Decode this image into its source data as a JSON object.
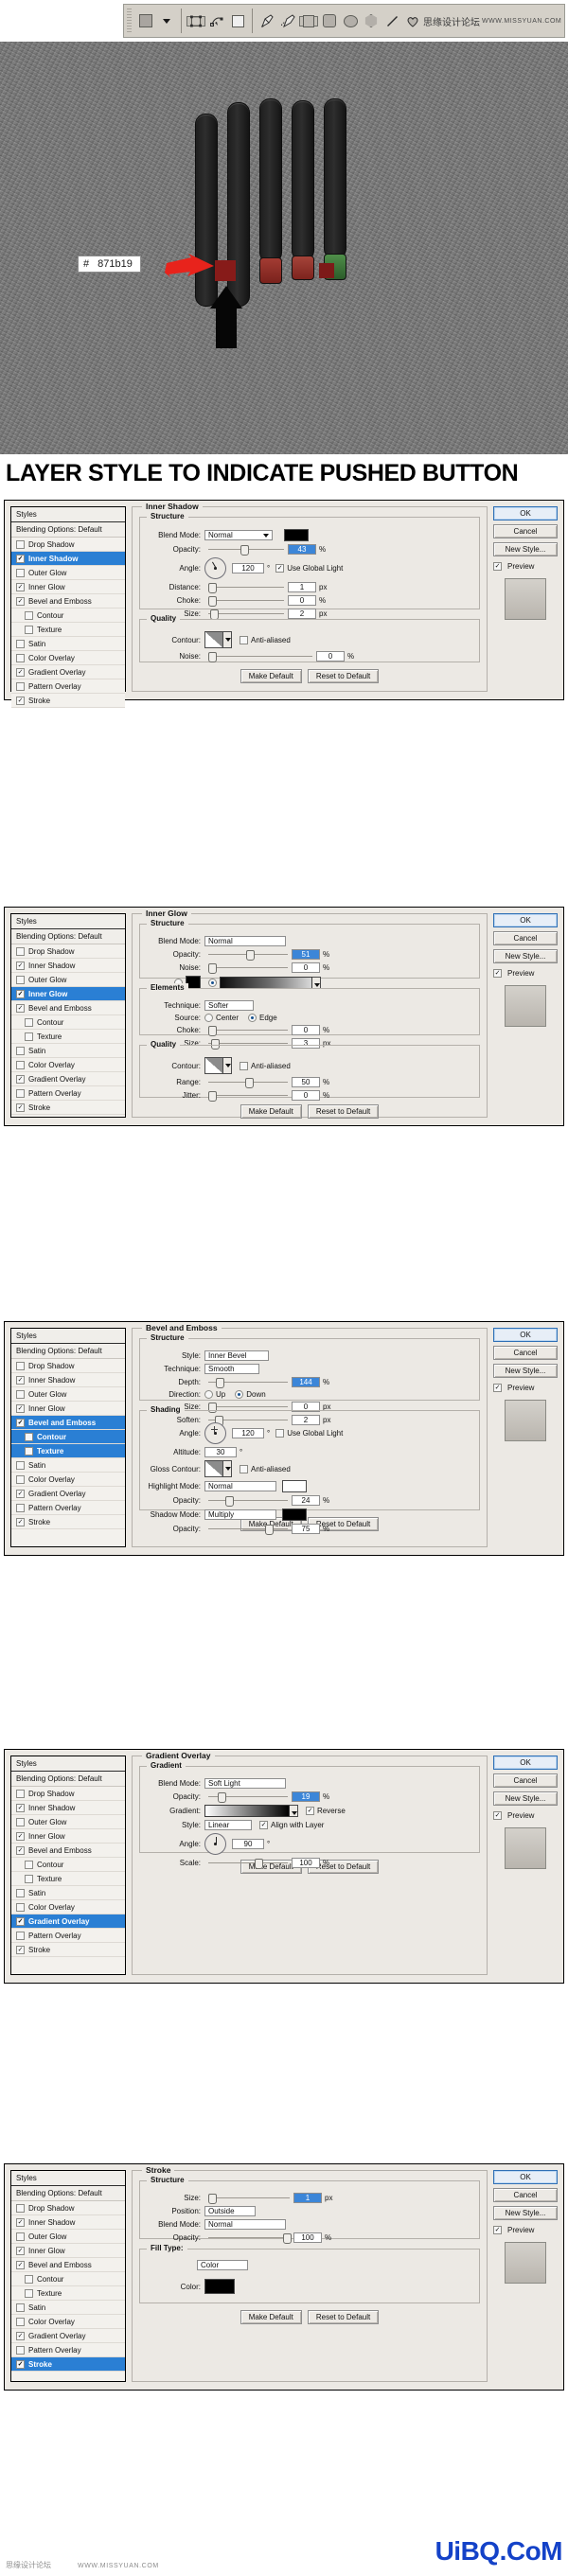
{
  "toolbar": {
    "shape_label": "shape-preset",
    "icons": [
      "shape-swatch",
      "dropdown-caret",
      "path-select-tool",
      "direct-select-tool",
      "mask-square",
      "pen-tool",
      "freeform-pen-tool",
      "rectangle-tool",
      "rounded-rectangle-tool",
      "ellipse-tool",
      "polygon-tool",
      "line-tool",
      "custom-shape-tool"
    ],
    "watermark_cn": "思缘设计论坛",
    "watermark_en": "WWW.MISSYUAN.COM"
  },
  "hero": {
    "hex_hash": "#",
    "hex_value": "871b19",
    "swatch_color": "#871b19",
    "arrow_color": "#e8231c"
  },
  "title": "LAYER STYLE TO INDICATE PUSHED BUTTON",
  "styles_panel": {
    "header": "Styles",
    "blending": "Blending Options: Default",
    "items": [
      {
        "label": "Drop Shadow",
        "checked": false,
        "indent": false
      },
      {
        "label": "Inner Shadow",
        "checked": true,
        "indent": false
      },
      {
        "label": "Outer Glow",
        "checked": false,
        "indent": false
      },
      {
        "label": "Inner Glow",
        "checked": true,
        "indent": false
      },
      {
        "label": "Bevel and Emboss",
        "checked": true,
        "indent": false
      },
      {
        "label": "Contour",
        "checked": false,
        "indent": true
      },
      {
        "label": "Texture",
        "checked": false,
        "indent": true
      },
      {
        "label": "Satin",
        "checked": false,
        "indent": false
      },
      {
        "label": "Color Overlay",
        "checked": false,
        "indent": false
      },
      {
        "label": "Gradient Overlay",
        "checked": true,
        "indent": false
      },
      {
        "label": "Pattern Overlay",
        "checked": false,
        "indent": false
      },
      {
        "label": "Stroke",
        "checked": true,
        "indent": false
      }
    ]
  },
  "buttons": {
    "ok": "OK",
    "cancel": "Cancel",
    "new_style": "New Style...",
    "preview": "Preview",
    "make_default": "Make Default",
    "reset_to_default": "Reset to Default"
  },
  "labels": {
    "structure": "Structure",
    "quality": "Quality",
    "elements": "Elements",
    "shading": "Shading",
    "gradient": "Gradient",
    "blend_mode": "Blend Mode:",
    "opacity": "Opacity:",
    "angle": "Angle:",
    "distance": "Distance:",
    "choke": "Choke:",
    "size": "Size:",
    "contour": "Contour:",
    "noise": "Noise:",
    "technique": "Technique:",
    "source": "Source:",
    "range": "Range:",
    "jitter": "Jitter:",
    "style": "Style:",
    "depth": "Depth:",
    "direction": "Direction:",
    "soften": "Soften:",
    "altitude": "Altitude:",
    "gloss_contour": "Gloss Contour:",
    "highlight_mode": "Highlight Mode:",
    "shadow_mode": "Shadow Mode:",
    "gradient_lbl": "Gradient:",
    "scale": "Scale:",
    "position": "Position:",
    "fill_type": "Fill Type:",
    "color": "Color:",
    "use_global_light": "Use Global Light",
    "anti_aliased": "Anti-aliased",
    "center": "Center",
    "edge": "Edge",
    "up": "Up",
    "down": "Down",
    "reverse": "Reverse",
    "align_with_layer": "Align with Layer",
    "percent": "%",
    "px": "px",
    "deg": "°"
  },
  "dialogs": [
    {
      "id": "inner-shadow",
      "title": "Inner Shadow",
      "active": "Inner Shadow",
      "blend_mode": "Normal",
      "opacity": "43",
      "angle": "120",
      "use_global_light": true,
      "distance": "1",
      "choke": "0",
      "size": "2",
      "noise": "0",
      "color": "#000000"
    },
    {
      "id": "inner-glow",
      "title": "Inner Glow",
      "active": "Inner Glow",
      "blend_mode": "Normal",
      "opacity": "51",
      "noise": "0",
      "technique": "Softer",
      "source": "Edge",
      "choke": "0",
      "size": "3",
      "range": "50",
      "jitter": "0",
      "color": "#000000"
    },
    {
      "id": "bevel-and-emboss",
      "title": "Bevel and Emboss",
      "active": "Bevel and Emboss",
      "style": "Inner Bevel",
      "technique": "Smooth",
      "depth": "144",
      "direction": "Down",
      "size": "0",
      "soften": "2",
      "angle": "120",
      "use_global_light": false,
      "altitude": "30",
      "anti_aliased": false,
      "highlight_mode": "Normal",
      "highlight_opacity": "24",
      "shadow_mode": "Multiply",
      "shadow_opacity": "75"
    },
    {
      "id": "gradient-overlay",
      "title": "Gradient Overlay",
      "active": "Gradient Overlay",
      "blend_mode": "Soft Light",
      "opacity": "19",
      "reverse": true,
      "style": "Linear",
      "align_with_layer": true,
      "angle": "90",
      "scale": "100"
    },
    {
      "id": "stroke",
      "title": "Stroke",
      "active": "Stroke",
      "size": "1",
      "position": "Outside",
      "blend_mode": "Normal",
      "opacity": "100",
      "fill_type": "Color",
      "color": "#111111"
    }
  ],
  "footer": {
    "watermark_cn": "思缘设计论坛",
    "watermark_en": "WWW.MISSYUAN.COM",
    "uibq": "UiBQ.CoM"
  }
}
